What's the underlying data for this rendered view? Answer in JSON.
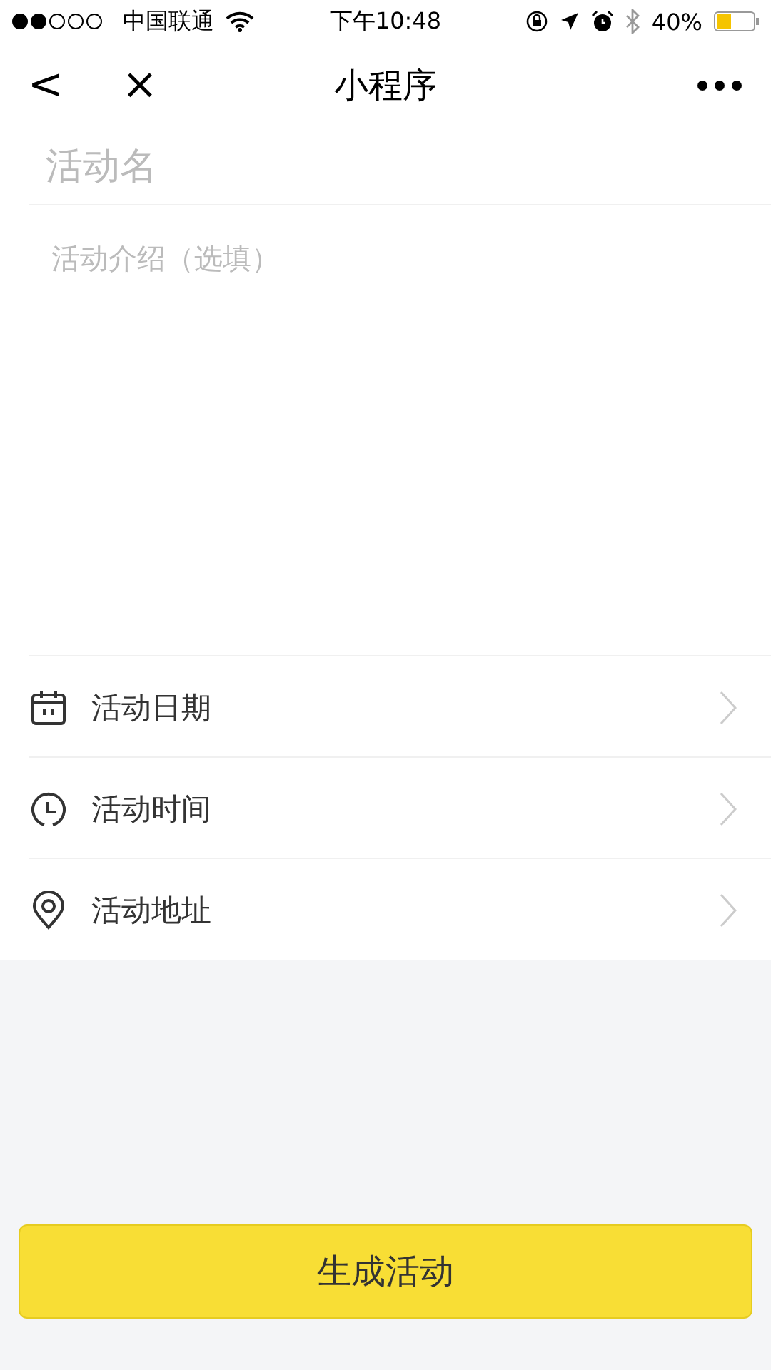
{
  "status_bar": {
    "carrier": "中国联通",
    "time": "下午10:48",
    "battery": "40%"
  },
  "nav": {
    "title": "小程序",
    "back": "<",
    "close": "×"
  },
  "form": {
    "name": {
      "placeholder": "活动名"
    },
    "intro": {
      "placeholder": "活动介绍（选填）"
    }
  },
  "rows": [
    {
      "kind": "calendar",
      "label": "活动日期"
    },
    {
      "kind": "clock",
      "label": "活动时间"
    },
    {
      "kind": "pin",
      "label": "活动地址"
    }
  ],
  "submit": "生成活动"
}
